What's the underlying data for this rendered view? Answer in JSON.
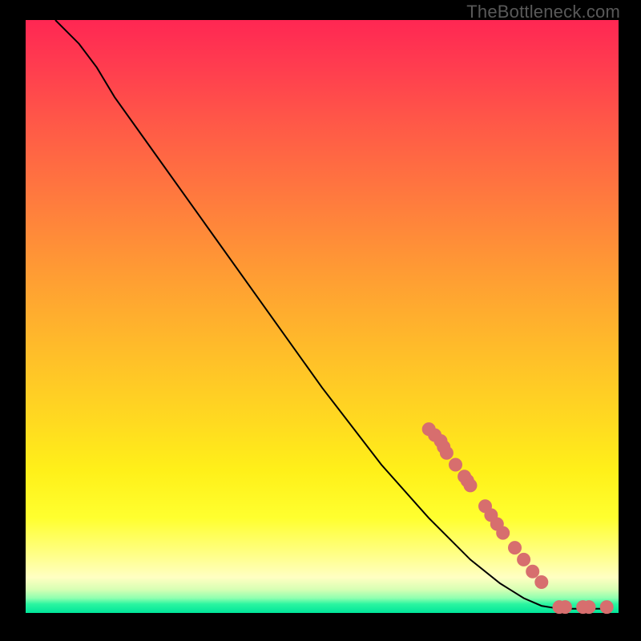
{
  "watermark": "TheBottleneck.com",
  "chart_data": {
    "type": "line",
    "xlim": [
      0,
      100
    ],
    "ylim": [
      0,
      100
    ],
    "curve": [
      {
        "x": 5,
        "y": 100
      },
      {
        "x": 7,
        "y": 98
      },
      {
        "x": 9,
        "y": 96
      },
      {
        "x": 12,
        "y": 92
      },
      {
        "x": 15,
        "y": 87
      },
      {
        "x": 20,
        "y": 80
      },
      {
        "x": 30,
        "y": 66
      },
      {
        "x": 40,
        "y": 52
      },
      {
        "x": 50,
        "y": 38
      },
      {
        "x": 60,
        "y": 25
      },
      {
        "x": 68,
        "y": 16
      },
      {
        "x": 75,
        "y": 9
      },
      {
        "x": 80,
        "y": 5
      },
      {
        "x": 84,
        "y": 2.5
      },
      {
        "x": 87,
        "y": 1.2
      },
      {
        "x": 90,
        "y": 0.7
      },
      {
        "x": 94,
        "y": 0.7
      },
      {
        "x": 98,
        "y": 0.7
      }
    ],
    "markers": [
      {
        "x": 68,
        "y": 31
      },
      {
        "x": 69,
        "y": 30
      },
      {
        "x": 70,
        "y": 29
      },
      {
        "x": 70.5,
        "y": 28
      },
      {
        "x": 71,
        "y": 27
      },
      {
        "x": 72.5,
        "y": 25
      },
      {
        "x": 74,
        "y": 23
      },
      {
        "x": 74.5,
        "y": 22.3
      },
      {
        "x": 75,
        "y": 21.5
      },
      {
        "x": 77.5,
        "y": 18
      },
      {
        "x": 78.5,
        "y": 16.5
      },
      {
        "x": 79.5,
        "y": 15
      },
      {
        "x": 80.5,
        "y": 13.5
      },
      {
        "x": 82.5,
        "y": 11
      },
      {
        "x": 84,
        "y": 9
      },
      {
        "x": 85.5,
        "y": 7
      },
      {
        "x": 87,
        "y": 5.2
      },
      {
        "x": 90,
        "y": 1
      },
      {
        "x": 91,
        "y": 1
      },
      {
        "x": 94,
        "y": 1
      },
      {
        "x": 95,
        "y": 1
      },
      {
        "x": 98,
        "y": 1
      }
    ],
    "colors": {
      "curve": "#000000",
      "marker_fill": "#d76e6e",
      "marker_stroke": "#d76e6e"
    }
  }
}
